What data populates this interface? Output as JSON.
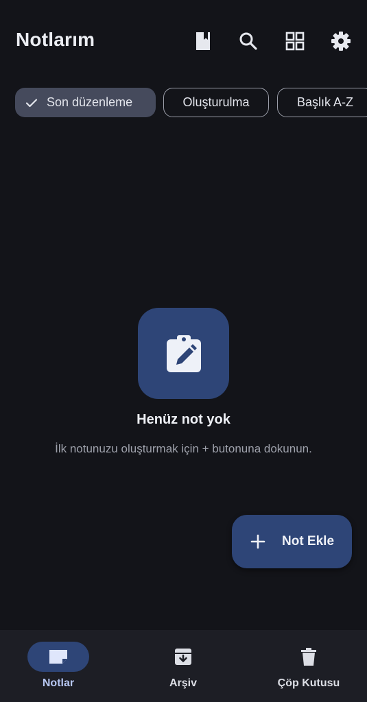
{
  "header": {
    "title": "Notlarım"
  },
  "actions": {
    "bookmark_icon": "bookmark-icon",
    "search_icon": "search-icon",
    "grid_icon": "grid-view-icon",
    "settings_icon": "settings-gear-icon"
  },
  "sort_chips": [
    {
      "label": "Son düzenleme",
      "selected": true
    },
    {
      "label": "Oluşturulma",
      "selected": false
    },
    {
      "label": "Başlık A-Z",
      "selected": false
    }
  ],
  "empty_state": {
    "icon": "clipboard-edit-icon",
    "title": "Henüz not yok",
    "subtitle": "İlk notunuzu oluşturmak için + butonuna dokunun."
  },
  "fab": {
    "icon": "plus-icon",
    "label": "Not Ekle"
  },
  "bottom_nav": {
    "items": [
      {
        "label": "Notlar",
        "icon": "note-icon",
        "active": true
      },
      {
        "label": "Arşiv",
        "icon": "archive-icon",
        "active": false
      },
      {
        "label": "Çöp Kutusu",
        "icon": "trash-icon",
        "active": false
      }
    ]
  },
  "colors": {
    "background": "#131419",
    "accent_container": "#2e4577",
    "selected_chip": "#454a5c",
    "bottom_nav": "#1d1e25"
  }
}
